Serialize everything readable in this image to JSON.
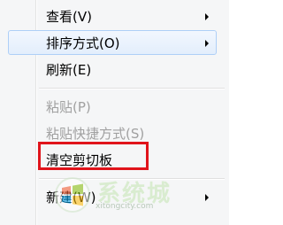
{
  "context_menu": {
    "items": [
      {
        "label": "查看(V)",
        "has_submenu": true,
        "enabled": true,
        "highlighted": false
      },
      {
        "label": "排序方式(O)",
        "has_submenu": true,
        "enabled": true,
        "highlighted": true
      },
      {
        "label": "刷新(E)",
        "has_submenu": false,
        "enabled": true,
        "highlighted": false
      },
      {
        "label": "粘贴(P)",
        "has_submenu": false,
        "enabled": false,
        "highlighted": false
      },
      {
        "label": "粘贴快捷方式(S)",
        "has_submenu": false,
        "enabled": false,
        "highlighted": false
      },
      {
        "label": "清空剪切板",
        "has_submenu": false,
        "enabled": true,
        "highlighted": false,
        "annotated": true
      },
      {
        "label": "新建(W)",
        "has_submenu": true,
        "enabled": true,
        "highlighted": false
      }
    ]
  },
  "watermark": {
    "text": "系统城",
    "url": "xitongcity.com",
    "icon": "windows-logo-icon"
  },
  "colors": {
    "annotation_box": "#e0141b",
    "highlight_border": "#aecff7",
    "menu_background": "#f5f6f7",
    "disabled_text": "#a0a0a0"
  }
}
